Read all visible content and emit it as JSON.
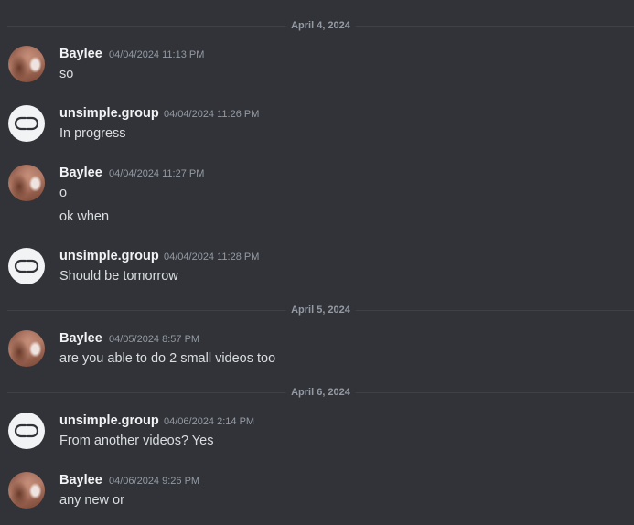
{
  "dividers": [
    {
      "label": "April 4, 2024"
    },
    {
      "label": "April 5, 2024"
    },
    {
      "label": "April 6, 2024"
    }
  ],
  "messages": [
    {
      "author": "Baylee",
      "timestamp": "04/04/2024 11:13 PM",
      "avatar_icon": "user-photo-avatar",
      "lines": [
        "so"
      ]
    },
    {
      "author": "unsimple.group",
      "timestamp": "04/04/2024 11:26 PM",
      "avatar_icon": "unsimple-logo-avatar",
      "lines": [
        "In progress"
      ]
    },
    {
      "author": "Baylee",
      "timestamp": "04/04/2024 11:27 PM",
      "avatar_icon": "user-photo-avatar",
      "lines": [
        "o",
        "ok when"
      ]
    },
    {
      "author": "unsimple.group",
      "timestamp": "04/04/2024 11:28 PM",
      "avatar_icon": "unsimple-logo-avatar",
      "lines": [
        "Should be tomorrow"
      ]
    },
    {
      "author": "Baylee",
      "timestamp": "04/05/2024 8:57 PM",
      "avatar_icon": "user-photo-avatar",
      "lines": [
        "are you able to do 2 small videos too"
      ]
    },
    {
      "author": "unsimple.group",
      "timestamp": "04/06/2024 2:14 PM",
      "avatar_icon": "unsimple-logo-avatar",
      "lines": [
        "From another videos? Yes"
      ]
    },
    {
      "author": "Baylee",
      "timestamp": "04/06/2024 9:26 PM",
      "avatar_icon": "user-photo-avatar",
      "lines": [
        "any new or"
      ]
    }
  ],
  "colors": {
    "background": "#313338",
    "author_text": "#f2f3f5",
    "message_text": "#dbdee1",
    "muted_text": "#949ba4",
    "divider_line": "#3f4147"
  }
}
